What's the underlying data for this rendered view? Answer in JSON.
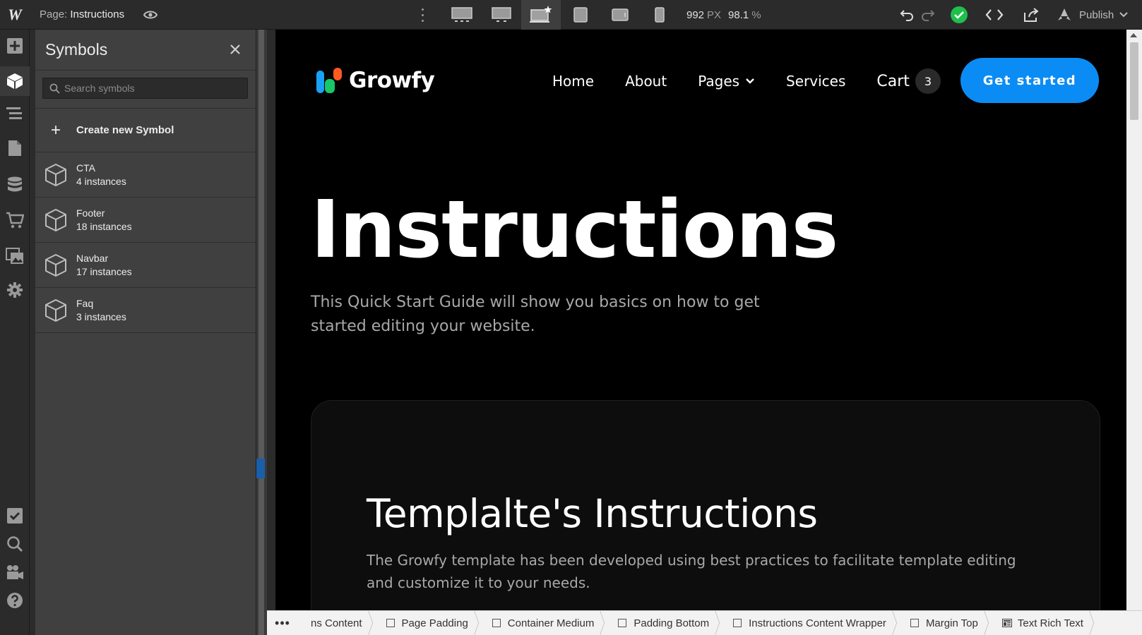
{
  "topbar": {
    "logo": "W",
    "page_prefix": "Page:",
    "page_name": "Instructions",
    "width_value": "992",
    "width_unit": "PX",
    "zoom_value": "98.1",
    "zoom_unit": "%",
    "publish_label": "Publish"
  },
  "symbols_panel": {
    "title": "Symbols",
    "search_placeholder": "Search symbols",
    "create_label": "Create new Symbol",
    "items": [
      {
        "name": "CTA",
        "count": "4 instances"
      },
      {
        "name": "Footer",
        "count": "18 instances"
      },
      {
        "name": "Navbar",
        "count": "17 instances"
      },
      {
        "name": "Faq",
        "count": "3 instances"
      }
    ]
  },
  "site": {
    "brand": "Growfy",
    "nav": {
      "home": "Home",
      "about": "About",
      "pages": "Pages",
      "services": "Services",
      "cart": "Cart",
      "cart_count": "3"
    },
    "cta": "Get started",
    "hero_title": "Instructions",
    "hero_subtitle": "This Quick Start Guide will show you basics on how to get started editing your website.",
    "card_title": "Templalte's Instructions",
    "card_text": "The Growfy template has been developed using best practices to facilitate template editing and customize it to your needs."
  },
  "breadcrumbs": {
    "more": "•••",
    "items": [
      "ns Content",
      "Page Padding",
      "Container Medium",
      "Padding Bottom",
      "Instructions Content Wrapper",
      "Margin Top",
      "Text Rich Text"
    ]
  },
  "colors": {
    "accent": "#0b8cf5",
    "status_ok": "#1fbf4c",
    "logo_blue": "#1aa0f5",
    "logo_orange": "#ff5a1f",
    "logo_green": "#18c76b"
  }
}
